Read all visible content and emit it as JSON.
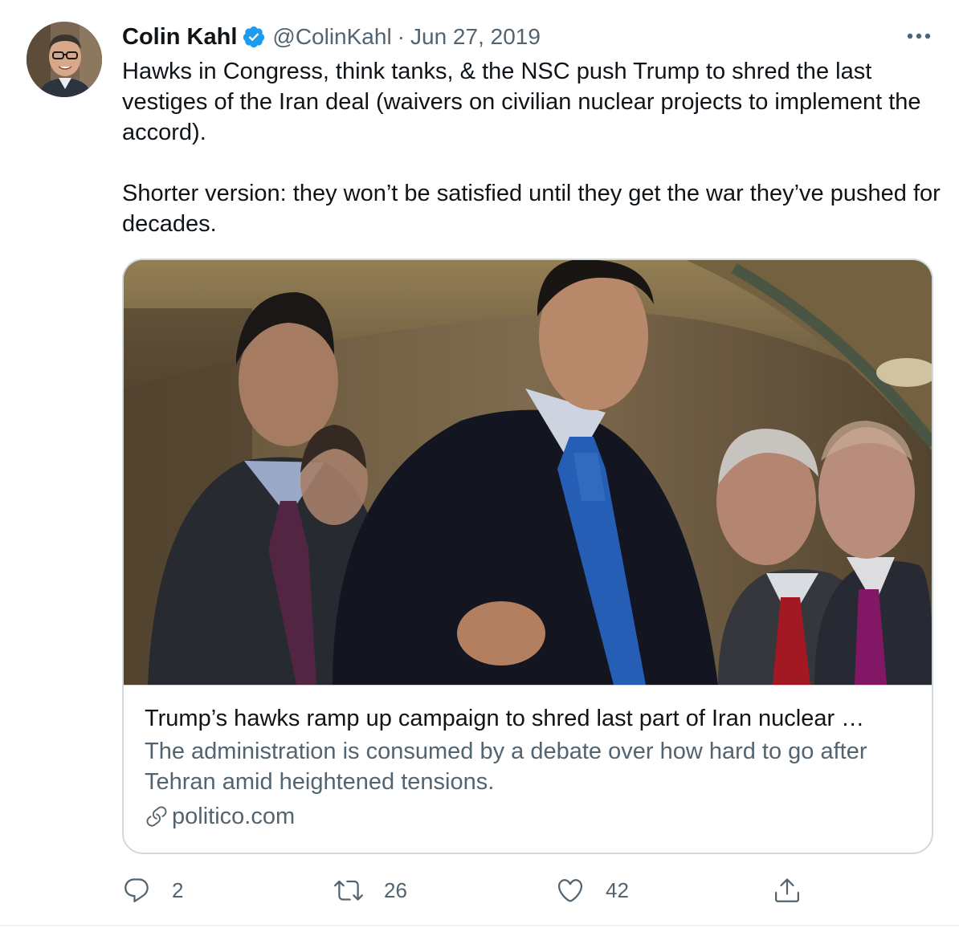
{
  "tweet": {
    "author": {
      "display_name": "Colin Kahl",
      "handle": "@ColinKahl",
      "verified": true
    },
    "separator": "·",
    "date": "Jun 27, 2019",
    "text_paragraphs": [
      "Hawks in Congress, think tanks, & the NSC push Trump to shred the last vestiges of the Iran deal (waivers on civilian nuclear projects to implement the accord).",
      "Shorter version: they won’t be satisfied until they get the war they’ve pushed for decades."
    ],
    "card": {
      "title": "Trump’s hawks ramp up campaign to shred last part of Iran nuclear …",
      "description": "The administration is consumed by a debate over how hard to go after Tehran amid heightened tensions.",
      "domain": "politico.com",
      "link_icon": "link-icon"
    },
    "actions": {
      "reply": {
        "icon": "reply-icon",
        "count": "2"
      },
      "retweet": {
        "icon": "retweet-icon",
        "count": "26"
      },
      "like": {
        "icon": "heart-icon",
        "count": "42"
      },
      "share": {
        "icon": "share-icon"
      }
    },
    "more_icon": "more-icon"
  },
  "colors": {
    "text_primary": "#0f1419",
    "text_secondary": "#536471",
    "verified_blue": "#1d9bf0",
    "border": "#cfd9de"
  }
}
